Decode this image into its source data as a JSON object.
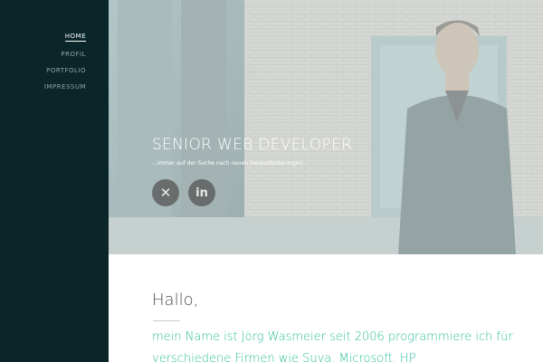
{
  "nav": {
    "items": [
      {
        "label": "HOME",
        "active": true
      },
      {
        "label": "PROFIL",
        "active": false
      },
      {
        "label": "PORTFOLIO",
        "active": false
      },
      {
        "label": "IMPRESSUM",
        "active": false
      }
    ]
  },
  "hero": {
    "title": "SENIOR WEB DEVELOPER",
    "subtitle": "...immer auf der Suche nach neuen Herausforderungen.",
    "social": [
      {
        "icon": "xing-icon",
        "glyph": "✕"
      },
      {
        "icon": "linkedin-icon",
        "glyph": "in"
      }
    ]
  },
  "content": {
    "greeting": "Hallo,",
    "intro": "mein Name ist Jörg Wasmeier seit 2006 programmiere ich für verschiedene Firmen wie Suva, Microsoft, HP"
  },
  "colors": {
    "sidebar_bg": "#0a2629",
    "accent": "#2bbf9a",
    "nav_text": "#8fa5a6"
  }
}
